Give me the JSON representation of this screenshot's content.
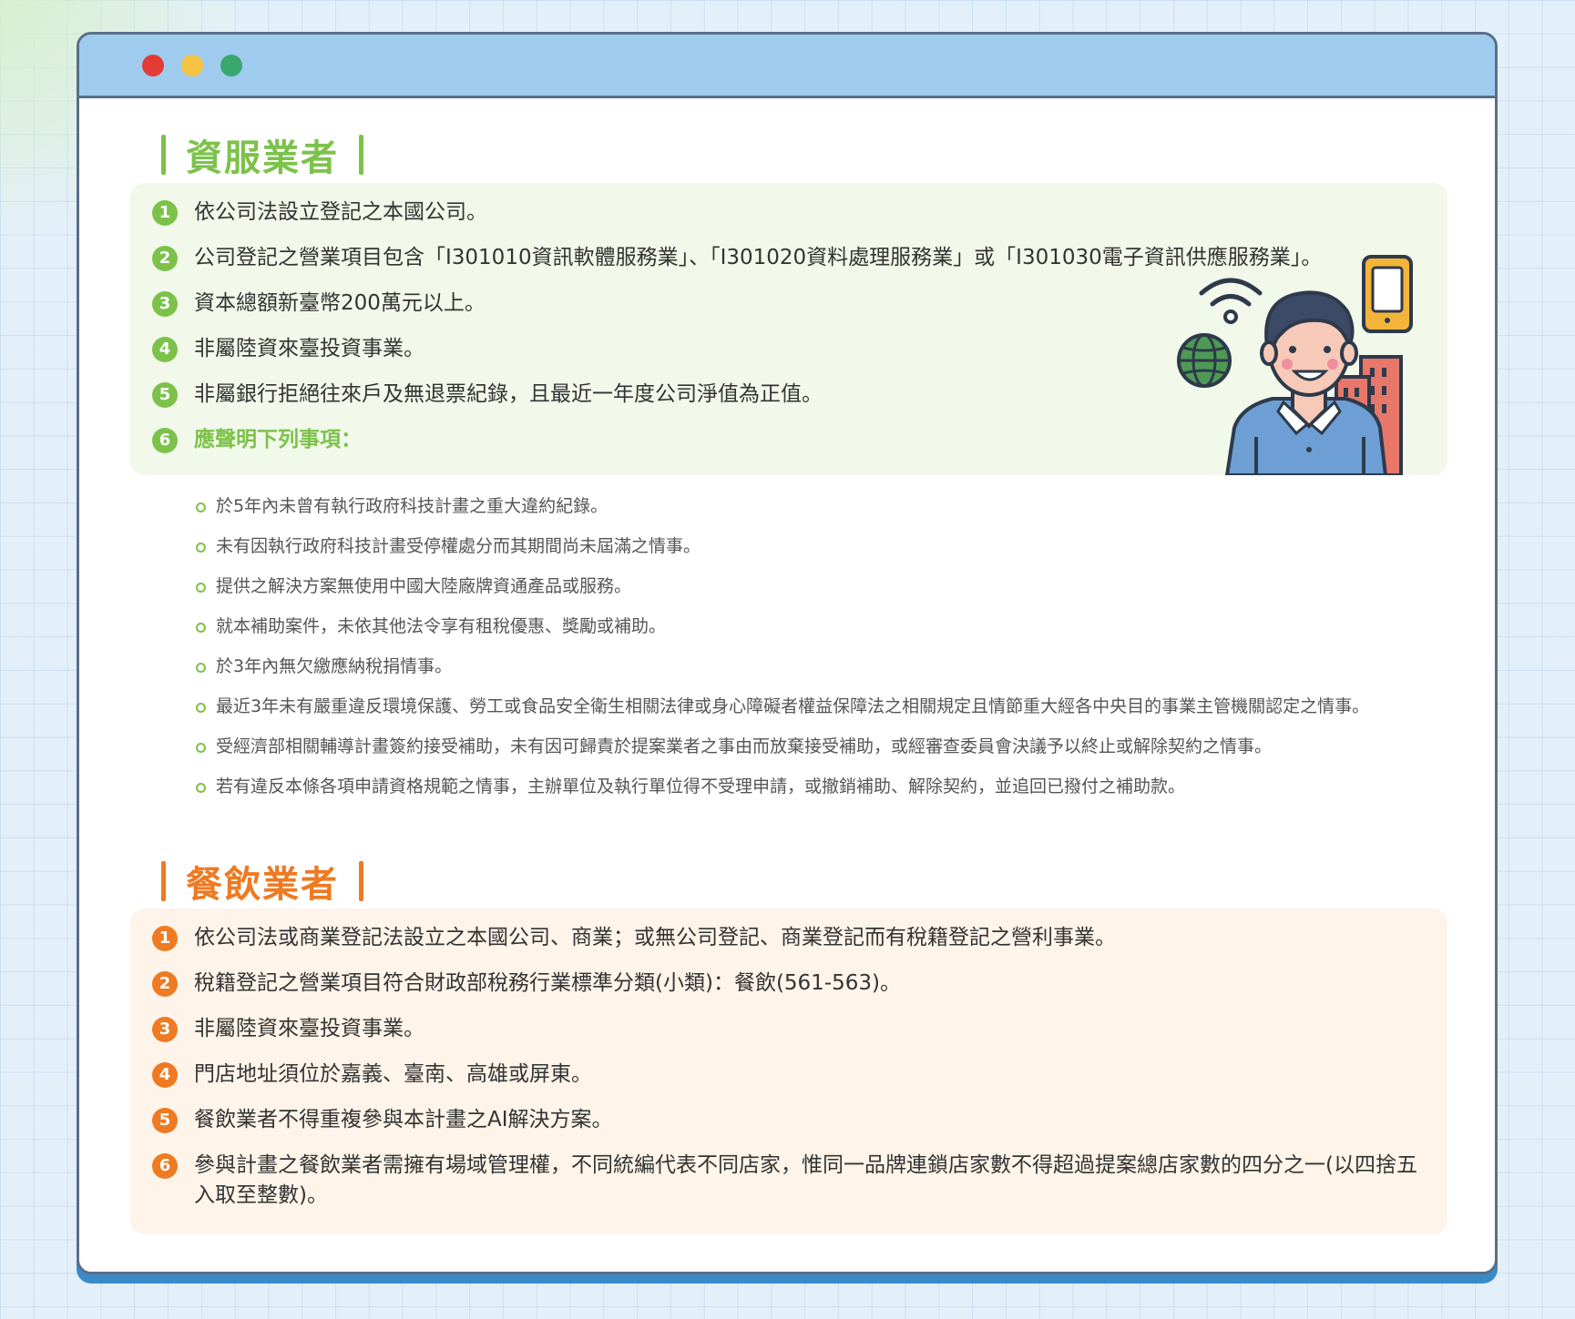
{
  "window": {
    "controls": [
      {
        "name": "close",
        "color": "#e43b36"
      },
      {
        "name": "minimize",
        "color": "#f6c343"
      },
      {
        "name": "maximize",
        "color": "#3aa76d"
      }
    ]
  },
  "sections": {
    "it": {
      "title": "資服業者",
      "accent": "#7cc24a",
      "items": [
        {
          "num": "1",
          "text": "依公司法設立登記之本國公司。"
        },
        {
          "num": "2",
          "text": "公司登記之營業項目包含「I301010資訊軟體服務業」、「I301020資料處理服務業」或「I301030電子資訊供應服務業」。"
        },
        {
          "num": "3",
          "text": "資本總額新臺幣200萬元以上。"
        },
        {
          "num": "4",
          "text": "非屬陸資來臺投資事業。"
        },
        {
          "num": "5",
          "text": "非屬銀行拒絕往來戶及無退票紀錄，且最近一年度公司淨值為正值。"
        },
        {
          "num": "6",
          "text": "應聲明下列事項："
        }
      ],
      "declarations": [
        "於5年內未曾有執行政府科技計畫之重大違約紀錄。",
        "未有因執行政府科技計畫受停權處分而其期間尚未屆滿之情事。",
        "提供之解決方案無使用中國大陸廠牌資通產品或服務。",
        "就本補助案件，未依其他法令享有租稅優惠、獎勵或補助。",
        "於3年內無欠繳應納稅捐情事。",
        "最近3年未有嚴重違反環境保護、勞工或食品安全衛生相關法律或身心障礙者權益保障法之相關規定且情節重大經各中央目的事業主管機關認定之情事。",
        "受經濟部相關輔導計畫簽約接受補助，未有因可歸責於提案業者之事由而放棄接受補助，或經審查委員會決議予以終止或解除契約之情事。",
        "若有違反本條各項申請資格規範之情事，主辦單位及執行單位得不受理申請，或撤銷補助、解除契約，並追回已撥付之補助款。"
      ],
      "illustration": "person-with-wifi-globe-phone-icon"
    },
    "food": {
      "title": "餐飲業者",
      "accent": "#ee7a22",
      "items": [
        {
          "num": "1",
          "text": "依公司法或商業登記法設立之本國公司、商業；或無公司登記、商業登記而有稅籍登記之營利事業。"
        },
        {
          "num": "2",
          "text": "稅籍登記之營業項目符合財政部稅務行業標準分類(小類)：餐飲(561-563)。"
        },
        {
          "num": "3",
          "text": "非屬陸資來臺投資事業。"
        },
        {
          "num": "4",
          "text": "門店地址須位於嘉義、臺南、高雄或屏東。"
        },
        {
          "num": "5",
          "text": "餐飲業者不得重複參與本計畫之AI解決方案。"
        },
        {
          "num": "6",
          "text": "參與計畫之餐飲業者需擁有場域管理權，不同統編代表不同店家，惟同一品牌連鎖店家數不得超過提案總店家數的四分之一(以四捨五入取至整數)。"
        }
      ]
    }
  }
}
